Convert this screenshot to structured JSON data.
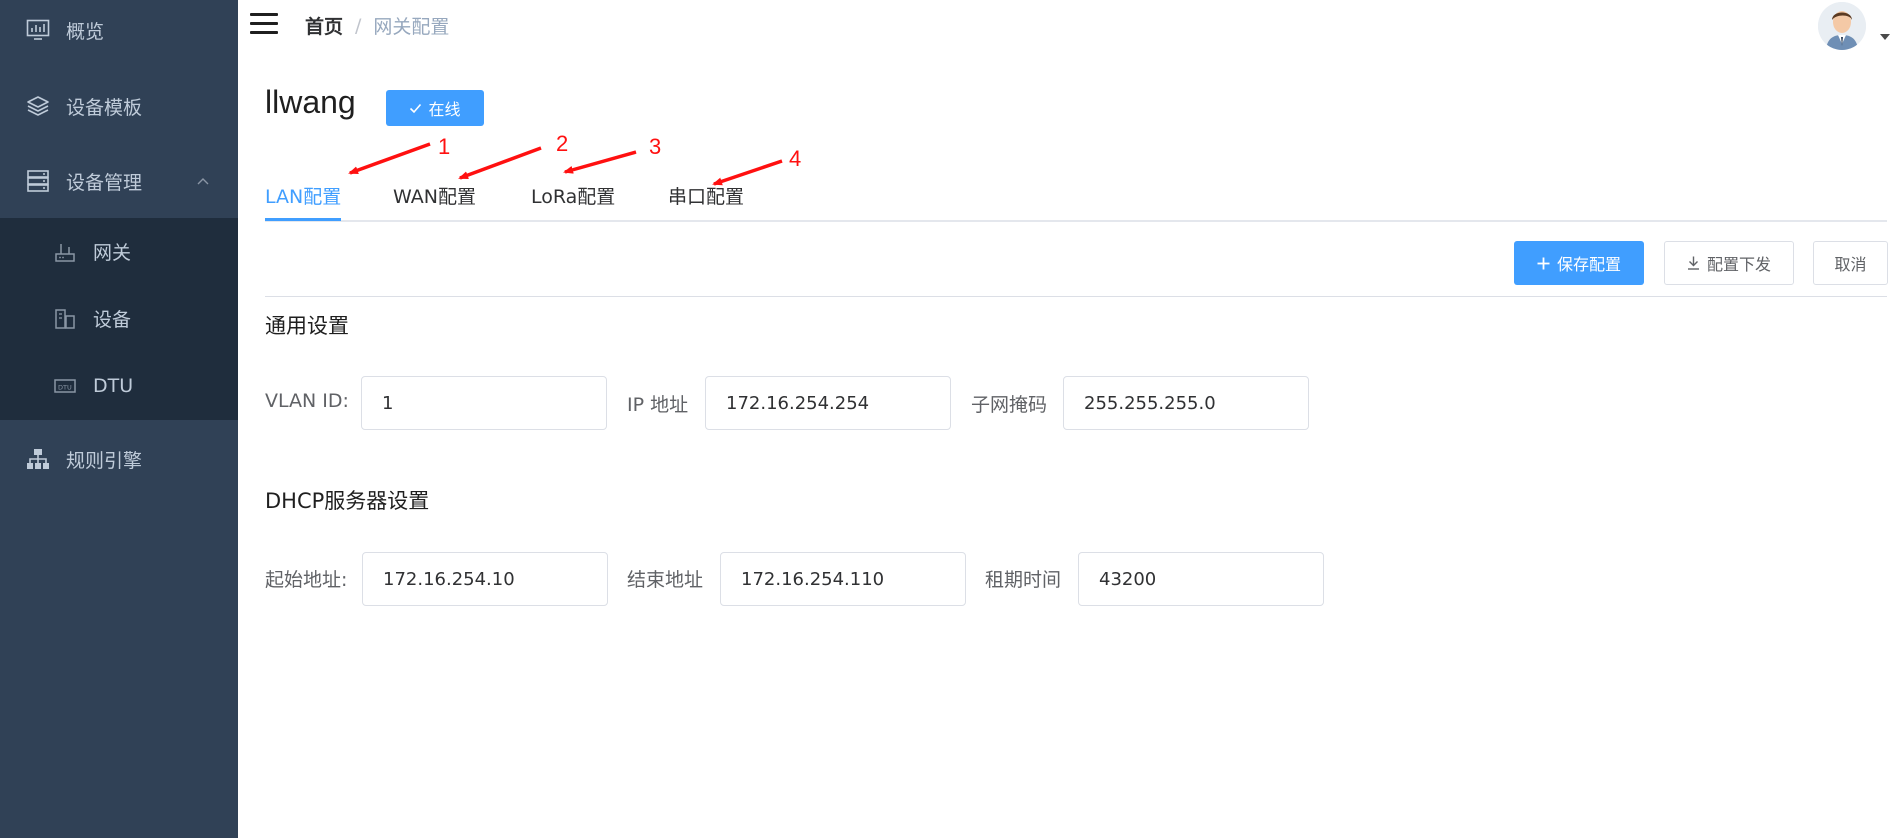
{
  "sidebar": {
    "items": [
      {
        "label": "概览",
        "icon": "chart-monitor-icon"
      },
      {
        "label": "设备模板",
        "icon": "layers-icon"
      },
      {
        "label": "设备管理",
        "icon": "server-icon",
        "expanded": true
      },
      {
        "label": "规则引擎",
        "icon": "sitemap-icon"
      }
    ],
    "subitems": [
      {
        "label": "网关",
        "icon": "router-icon"
      },
      {
        "label": "设备",
        "icon": "device-icon"
      },
      {
        "label": "DTU",
        "icon": "dtu-icon"
      }
    ],
    "background": "#304156",
    "submenu_background": "#1f2d3d",
    "text_color": "#bfcbd9"
  },
  "header": {
    "breadcrumb": {
      "home": "首页",
      "separator": "/",
      "current": "网关配置"
    }
  },
  "page": {
    "title": "llwang",
    "status_label": "在线"
  },
  "tabs": [
    {
      "label": "LAN配置",
      "active": true
    },
    {
      "label": "WAN配置",
      "active": false
    },
    {
      "label": "LoRa配置",
      "active": false
    },
    {
      "label": "串口配置",
      "active": false
    }
  ],
  "annotations": [
    "1",
    "2",
    "3",
    "4"
  ],
  "toolbar": {
    "save_label": "保存配置",
    "deploy_label": "配置下发",
    "cancel_label": "取消"
  },
  "general": {
    "title": "通用设置",
    "vlan_label": "VLAN ID:",
    "vlan_value": "1",
    "ip_label": "IP 地址",
    "ip_value": "172.16.254.254",
    "mask_label": "子网掩码",
    "mask_value": "255.255.255.0"
  },
  "dhcp": {
    "title": "DHCP服务器设置",
    "start_label": "起始地址:",
    "start_value": "172.16.254.10",
    "end_label": "结束地址",
    "end_value": "172.16.254.110",
    "lease_label": "租期时间",
    "lease_value": "43200"
  },
  "colors": {
    "primary": "#409eff",
    "annotation": "#ff1010"
  }
}
